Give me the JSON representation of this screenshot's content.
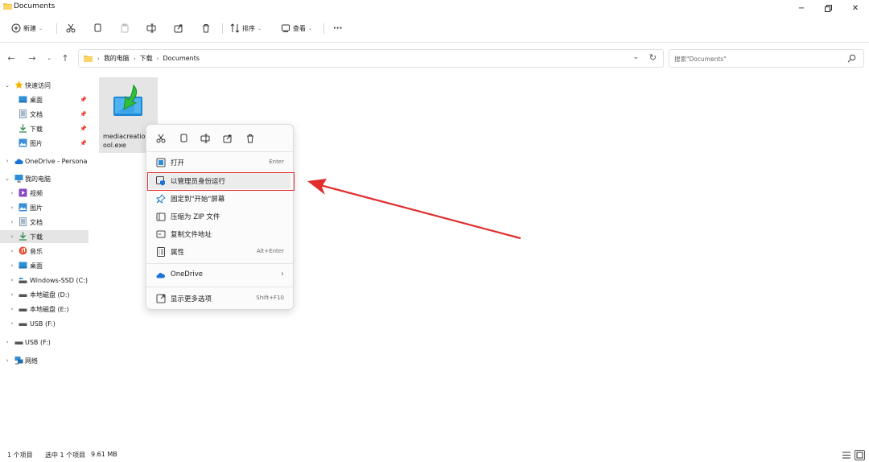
{
  "window": {
    "title": "Documents",
    "controls": {
      "minimize": "−",
      "maximize": "□",
      "close": "✕"
    }
  },
  "toolbar": {
    "new_label": "新建",
    "sort_label": "排序",
    "view_label": "查看",
    "more_label": "···"
  },
  "address": {
    "crumbs": [
      "我的电脑",
      "下载",
      "Documents"
    ],
    "search_placeholder": "搜索\"Documents\""
  },
  "sidebar": {
    "quick_access": "快速访问",
    "quick_items": [
      "桌面",
      "文档",
      "下载",
      "图片"
    ],
    "onedrive": "OneDrive - Persona",
    "this_pc": "我的电脑",
    "pc_items": [
      "视频",
      "图片",
      "文档",
      "下载",
      "音乐",
      "桌面",
      "Windows-SSD (C:)",
      "本地磁盘 (D:)",
      "本地磁盘 (E:)",
      "USB (F:)"
    ],
    "usb": "USB (F:)",
    "network": "网络"
  },
  "file": {
    "name": "mediacreationtool.exe",
    "name_display": "mediacreatio\nool.exe"
  },
  "context_menu": {
    "items": [
      {
        "label": "打开",
        "shortcut": "Enter"
      },
      {
        "label": "以管理员身份运行",
        "shortcut": ""
      },
      {
        "label": "固定到\"开始\"屏幕",
        "shortcut": ""
      },
      {
        "label": "压缩为 ZIP 文件",
        "shortcut": ""
      },
      {
        "label": "复制文件地址",
        "shortcut": ""
      },
      {
        "label": "属性",
        "shortcut": "Alt+Enter"
      },
      {
        "label": "OneDrive",
        "shortcut": "›"
      },
      {
        "label": "显示更多选项",
        "shortcut": "Shift+F10"
      }
    ]
  },
  "status": {
    "count": "1 个项目",
    "selected": "选中 1 个项目",
    "size": "9.61 MB"
  },
  "colors": {
    "annotation_red": "#e12d2d",
    "folder_yellow": "#f4c542",
    "onedrive_blue": "#1a73d9"
  }
}
